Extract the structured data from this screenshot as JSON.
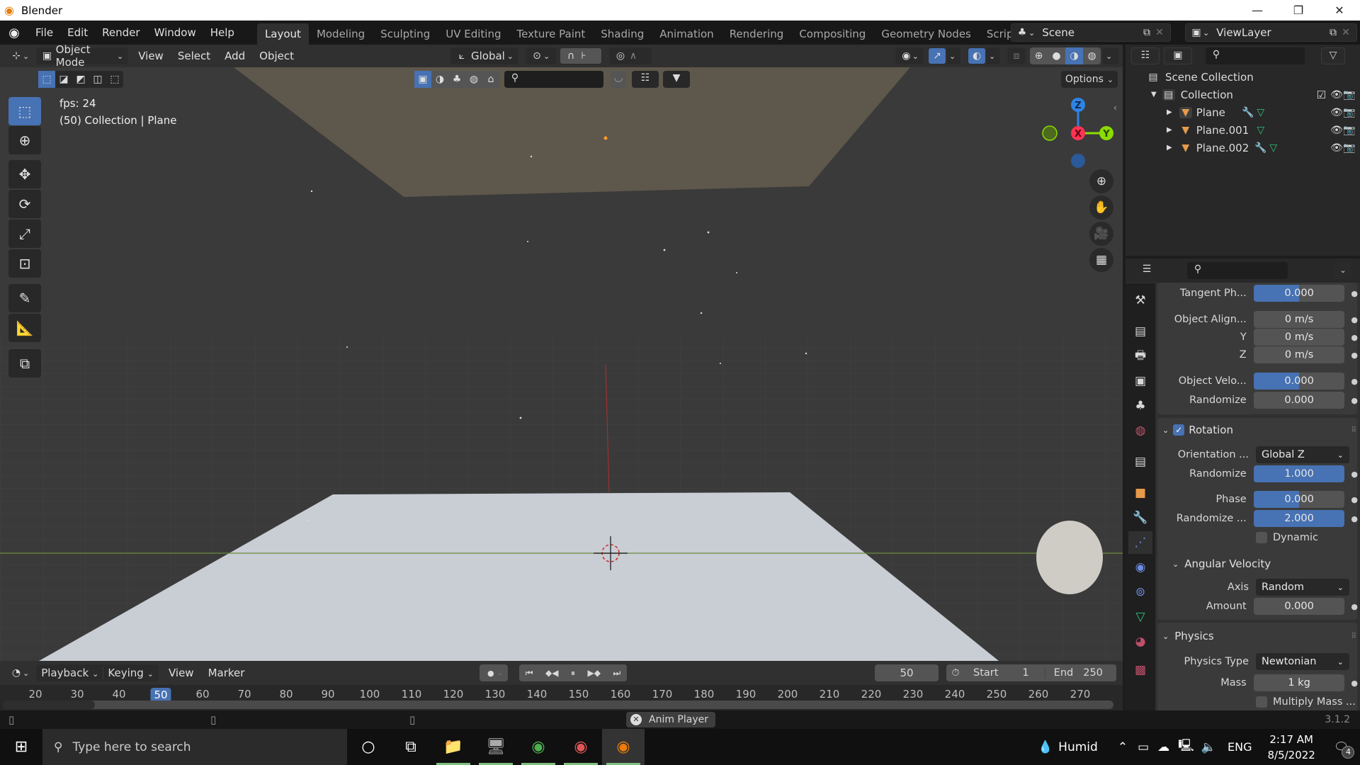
{
  "window": {
    "title": "Blender",
    "minimize_icon": "minimize-icon",
    "restore_icon": "restore-icon",
    "close_icon": "close-icon"
  },
  "menu": {
    "items": [
      "File",
      "Edit",
      "Render",
      "Window",
      "Help"
    ]
  },
  "workspaces": {
    "tabs": [
      "Layout",
      "Modeling",
      "Sculpting",
      "UV Editing",
      "Texture Paint",
      "Shading",
      "Animation",
      "Rendering",
      "Compositing",
      "Geometry Nodes",
      "Scripting"
    ],
    "active": "Layout",
    "add_label": "+"
  },
  "scene": {
    "name": "Scene",
    "view_layer": "ViewLayer"
  },
  "viewport_header": {
    "mode": "Object Mode",
    "menus": [
      "View",
      "Select",
      "Add",
      "Object"
    ],
    "transform_orientation": "Global",
    "options_label": "Options"
  },
  "viewport": {
    "fps_text": "fps: 24",
    "object_info": "(50) Collection | Plane",
    "gizmo": {
      "z": "Z",
      "x": "X",
      "y": "Y"
    },
    "colors": {
      "x_axis": "#ff3352",
      "y_axis": "#8bdc00",
      "z_axis": "#2f83e3",
      "floor": "#c9cdd4",
      "ceiling": "#5e574b",
      "background": "#3a3a3a"
    }
  },
  "outliner": {
    "scene_collection": "Scene Collection",
    "collection": "Collection",
    "objects": [
      {
        "name": "Plane",
        "has_modifier": true
      },
      {
        "name": "Plane.001",
        "has_modifier": false
      },
      {
        "name": "Plane.002",
        "has_modifier": true
      }
    ]
  },
  "properties": {
    "rows_top": [
      {
        "label": "Tangent Ph...",
        "value": "0.000",
        "fill": 0.5
      },
      {
        "label": "Object Align...",
        "value": "0 m/s",
        "fill": 0
      },
      {
        "label": "Y",
        "value": "0 m/s",
        "fill": 0
      },
      {
        "label": "Z",
        "value": "0 m/s",
        "fill": 0
      },
      {
        "label": "Object Velo...",
        "value": "0.000",
        "fill": 0.5
      },
      {
        "label": "Randomize",
        "value": "0.000",
        "fill": 0
      }
    ],
    "rotation": {
      "title": "Rotation",
      "enabled": true,
      "orientation_label": "Orientation ...",
      "orientation_value": "Global Z",
      "randomize_label": "Randomize",
      "randomize_value": "1.000",
      "randomize_fill": 1.0,
      "phase_label": "Phase",
      "phase_value": "0.000",
      "phase_fill": 0.5,
      "randomize_phase_label": "Randomize ...",
      "randomize_phase_value": "2.000",
      "randomize_phase_fill": 1.0,
      "dynamic_label": "Dynamic",
      "dynamic_checked": false
    },
    "angular_velocity": {
      "title": "Angular Velocity",
      "axis_label": "Axis",
      "axis_value": "Random",
      "amount_label": "Amount",
      "amount_value": "0.000"
    },
    "physics": {
      "title": "Physics",
      "type_label": "Physics Type",
      "type_value": "Newtonian",
      "mass_label": "Mass",
      "mass_value": "1 kg",
      "multiply_mass_label": "Multiply Mass ...",
      "multiply_mass_checked": false
    }
  },
  "timeline": {
    "menus": [
      "Playback",
      "Keying",
      "View",
      "Marker"
    ],
    "current_frame": "50",
    "start_label": "Start",
    "start": "1",
    "end_label": "End",
    "end": "250",
    "ticks": [
      "20",
      "30",
      "40",
      "50",
      "60",
      "70",
      "80",
      "90",
      "100",
      "110",
      "120",
      "130",
      "140",
      "150",
      "160",
      "170",
      "180",
      "190",
      "200",
      "210",
      "220",
      "230",
      "240",
      "250",
      "260",
      "270"
    ]
  },
  "status": {
    "anim_player": "Anim Player",
    "version": "3.1.2"
  },
  "taskbar": {
    "search_placeholder": "Type here to search",
    "weather": "Humid",
    "language": "ENG",
    "time": "2:17 AM",
    "date": "8/5/2022",
    "notifications": "4"
  }
}
